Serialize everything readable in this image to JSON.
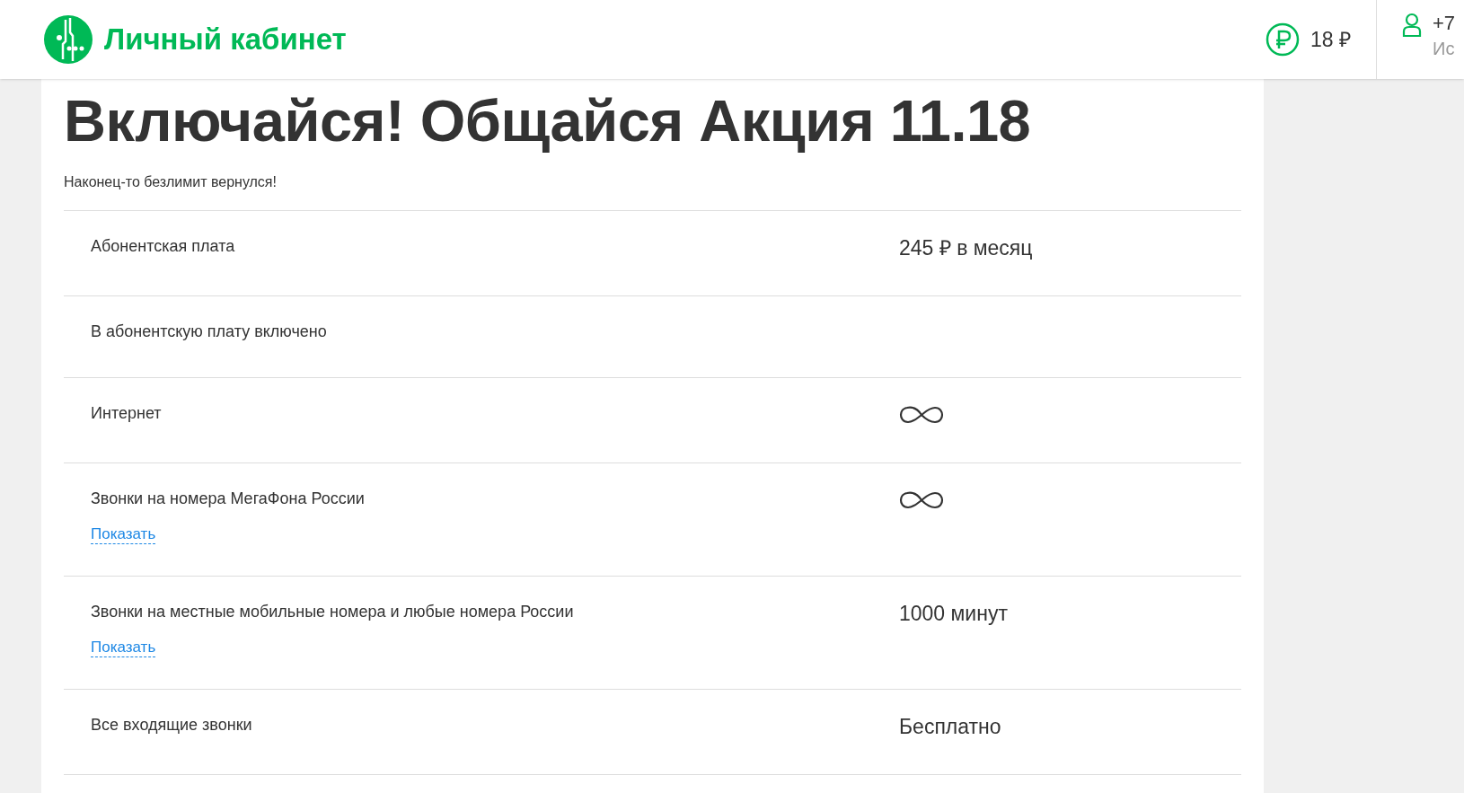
{
  "header": {
    "title": "Личный кабинет",
    "balance": "18 ₽",
    "phone": "+7",
    "account_line": "Ис"
  },
  "tariff": {
    "title": "Включайся! Общайся Акция 11.18",
    "subtitle": "Наконец-то безлимит вернулся!"
  },
  "rows": [
    {
      "label": "Абонентская плата",
      "value": {
        "kind": "text",
        "text": "245 ₽ в месяц"
      }
    },
    {
      "label": "В абонентскую плату включено"
    },
    {
      "label": "Интернет",
      "value": {
        "kind": "infinity"
      }
    },
    {
      "label": "Звонки на номера МегаФона России",
      "link": "Показать",
      "value": {
        "kind": "infinity"
      }
    },
    {
      "label": "Звонки на местные мобильные номера и любые номера России",
      "link": "Показать",
      "value": {
        "kind": "text",
        "text": "1000 минут"
      }
    },
    {
      "label": "Все входящие звонки",
      "value": {
        "kind": "text",
        "text": "Бесплатно"
      }
    }
  ]
}
